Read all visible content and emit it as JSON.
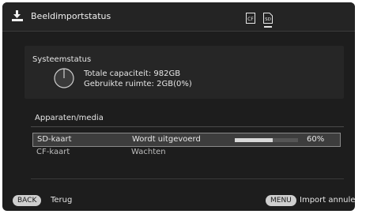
{
  "header": {
    "title": "Beeldimportstatus",
    "title_icon": "import-icon",
    "cf_icon_label": "CF",
    "sd_icon_label": "SD"
  },
  "system": {
    "label": "Systeemstatus",
    "total_capacity": "Totale capaciteit: 982GB",
    "used_space": "Gebruikte ruimte: 2GB(0%)",
    "used_fraction": 0.002
  },
  "media": {
    "label": "Apparaten/media",
    "devices": [
      {
        "name": "SD-kaart",
        "status": "Wordt uitgevoerd",
        "progress": 60,
        "progress_text": "60%"
      },
      {
        "name": "CF-kaart",
        "status": "Wachten"
      }
    ]
  },
  "footer": {
    "back_key": "BACK",
    "back_label": "Terug",
    "menu_key": "MENU",
    "menu_label": "Import annuleren"
  },
  "colors": {
    "screen_bg": "#1d1d1d",
    "panel_bg": "#262626",
    "pill_bg": "#cfcfcf"
  }
}
